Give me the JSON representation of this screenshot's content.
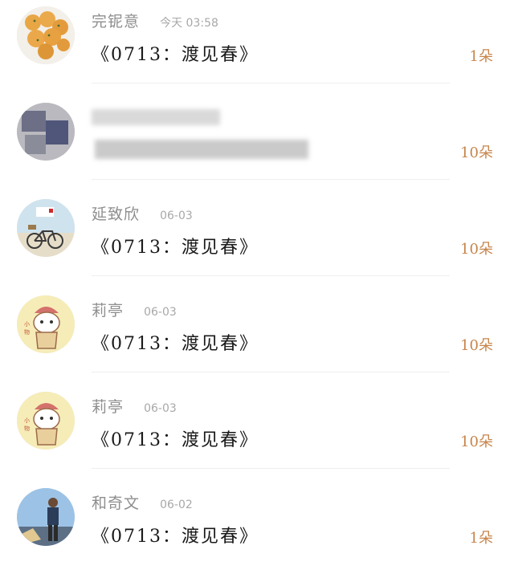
{
  "records": [
    {
      "name": "完铌意",
      "time": "今天 03:58",
      "message": "《0713：渡见春》",
      "amount": "1朵",
      "avatar": "food-balls"
    },
    {
      "name": "",
      "time": "",
      "message": "",
      "amount": "10朵",
      "avatar": "blurred"
    },
    {
      "name": "延致欣",
      "time": "06-03",
      "message": "《0713：渡见春》",
      "amount": "10朵",
      "avatar": "bicycle-scene"
    },
    {
      "name": "莉亭",
      "time": "06-03",
      "message": "《0713：渡见春》",
      "amount": "10朵",
      "avatar": "cartoon-cat"
    },
    {
      "name": "莉亭",
      "time": "06-03",
      "message": "《0713：渡见春》",
      "amount": "10朵",
      "avatar": "cartoon-cat"
    },
    {
      "name": "和奇文",
      "time": "06-02",
      "message": "《0713：渡见春》",
      "amount": "1朵",
      "avatar": "person-outdoors"
    }
  ]
}
